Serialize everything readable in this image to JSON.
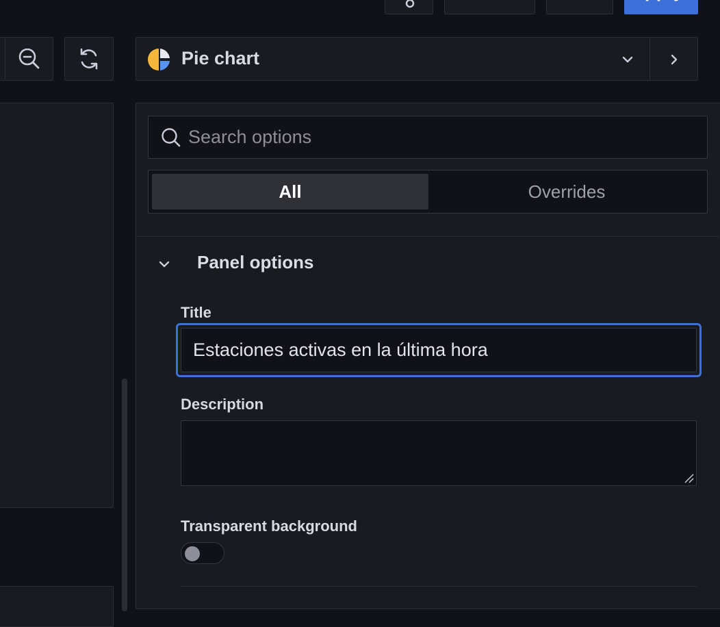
{
  "visualization": {
    "selected": "Pie chart",
    "icon": "pie-chart-icon"
  },
  "toolbar": {
    "zoom_out_icon": "zoom-out-icon",
    "refresh_icon": "refresh-icon",
    "top_settings_icon": "gear-icon"
  },
  "options": {
    "search_placeholder": "Search options",
    "tabs": [
      {
        "label": "All",
        "active": true
      },
      {
        "label": "Overrides",
        "active": false
      }
    ],
    "panel_options": {
      "section_title": "Panel options",
      "title_label": "Title",
      "title_value": "Estaciones activas en la última hora",
      "description_label": "Description",
      "description_value": "",
      "transparent_label": "Transparent background",
      "transparent_on": false
    }
  },
  "colors": {
    "accent": "#3d71d9",
    "background": "#111217",
    "panel": "#181b1f",
    "border": "#2c2e35"
  }
}
